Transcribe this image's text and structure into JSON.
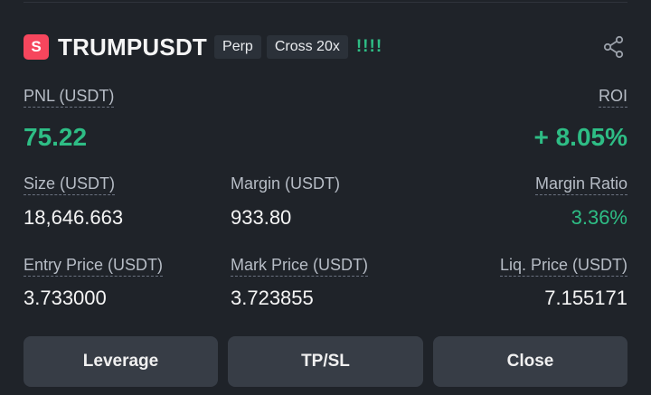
{
  "header": {
    "badge_letter": "S",
    "symbol": "TRUMPUSDT",
    "contract_type": "Perp",
    "margin_mode": "Cross 20x",
    "risk_indicator": "!!!!",
    "share_icon": "share-icon"
  },
  "pnl": {
    "label": "PNL (USDT)",
    "value": "75.22"
  },
  "roi": {
    "label": "ROI",
    "value": "+ 8.05%"
  },
  "size": {
    "label": "Size (USDT)",
    "value": "18,646.663"
  },
  "margin": {
    "label": "Margin (USDT)",
    "value": "933.80"
  },
  "margin_ratio": {
    "label": "Margin Ratio",
    "value": "3.36%"
  },
  "entry_price": {
    "label": "Entry Price (USDT)",
    "value": "3.733000"
  },
  "mark_price": {
    "label": "Mark Price (USDT)",
    "value": "3.723855"
  },
  "liq_price": {
    "label": "Liq. Price (USDT)",
    "value": "7.155171"
  },
  "buttons": {
    "leverage": "Leverage",
    "tpsl": "TP/SL",
    "close": "Close"
  },
  "colors": {
    "profit_green": "#2ebd85",
    "badge_red": "#f6465d",
    "background": "#1f2329"
  }
}
